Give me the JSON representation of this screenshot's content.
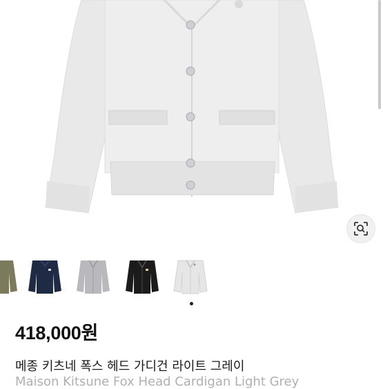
{
  "product": {
    "image_alt": "Light grey cardigan",
    "price": "418,000원",
    "title_korean": "메종 키츠네 폭스 헤드 가디건 라이트 그레이",
    "title_english": "Maison Kitsune Fox Head Cardigan Light Grey"
  },
  "gallery": {
    "thumbnails": [
      {
        "name": "khaki cardigan",
        "color": "#7b7a5c"
      },
      {
        "name": "navy cardigan",
        "color": "#1f2a44"
      },
      {
        "name": "grey cardigan",
        "color": "#b9b9bd"
      },
      {
        "name": "black cardigan",
        "color": "#1b1b1b"
      },
      {
        "name": "light grey cardigan",
        "color": "#e6e6e6"
      }
    ],
    "selected_index": 4
  },
  "icons": {
    "visual_search": "lens-search-icon"
  }
}
